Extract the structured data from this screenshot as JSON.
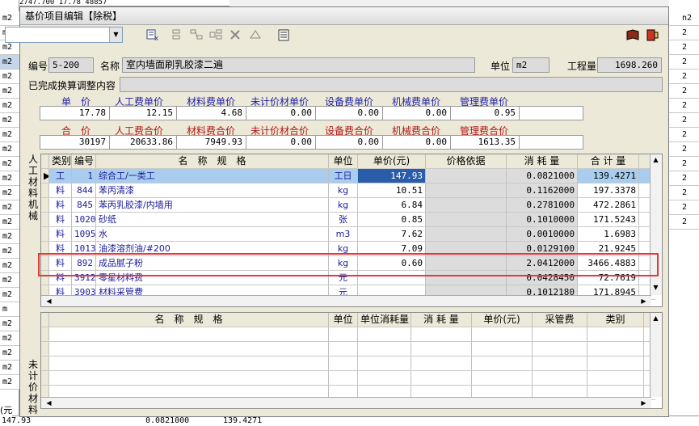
{
  "background": {
    "left_units": [
      "m2",
      "m2",
      "m2",
      "m2",
      "m2",
      "m2",
      "m2",
      "m2",
      "m2",
      "m2",
      "m2",
      "m2",
      "m2",
      "m2",
      "m2",
      "m2",
      "m2",
      "m2",
      "m2",
      "m2",
      "m",
      "m2",
      "m2",
      "m2",
      "m2",
      "m2"
    ],
    "top_row": "2747.700      17.78      48857",
    "right_units": [
      "n2",
      "2",
      "2",
      "2",
      "2",
      "2",
      "2",
      "2",
      "2",
      "2",
      "2",
      "2",
      "2",
      "2",
      "2"
    ],
    "bottom_left": "(元",
    "bottom_row": [
      "147.93",
      "0.0821000",
      "139.4271"
    ]
  },
  "dialog": {
    "title": "基价项目编辑【除税】",
    "toolbar": {
      "combo_value": ""
    },
    "info": {
      "code_label": "编号",
      "code_value": "5-200",
      "name_label": "名称",
      "name_value": "室内墙面刷乳胶漆二遍",
      "unit_label": "单位",
      "unit_value": "m2",
      "qty_label": "工程量",
      "qty_value": "1698.260",
      "adjust_label": "已完成换算调整内容",
      "adjust_value": ""
    },
    "unit_price": {
      "headers": [
        "单　价",
        "人工费单价",
        "材料费单价",
        "未计价材单价",
        "设备费单价",
        "机械费单价",
        "管理费单价"
      ],
      "values": [
        "17.78",
        "12.15",
        "4.68",
        "0.00",
        "0.00",
        "0.00",
        "0.95",
        ""
      ]
    },
    "total_price": {
      "headers": [
        "合　价",
        "人工费合价",
        "材料费合价",
        "未计价材合价",
        "设备费合价",
        "机械费合价",
        "管理费合价"
      ],
      "values": [
        "30197",
        "20633.86",
        "7949.93",
        "0.00",
        "0.00",
        "0.00",
        "1613.35",
        ""
      ]
    },
    "side_label_top": "人工材料机械",
    "side_label_bottom": "未计价材料",
    "grid": {
      "headers": [
        "类别",
        "编号",
        "名　称　规　格",
        "单位",
        "单价(元)",
        "价格依据",
        "消 耗 量",
        "合 计 量"
      ],
      "rows": [
        {
          "type": "工",
          "code": "1",
          "name": "综合工/一类工",
          "unit": "工日",
          "price": "147.93",
          "basis": "",
          "qty": "0.0821000",
          "total": "139.4271",
          "selected": true
        },
        {
          "type": "料",
          "code": "844",
          "name": "苯丙清漆",
          "unit": "kg",
          "price": "10.51",
          "basis": "",
          "qty": "0.1162000",
          "total": "197.3378"
        },
        {
          "type": "料",
          "code": "845",
          "name": "苯丙乳胶漆/内墙用",
          "unit": "kg",
          "price": "6.84",
          "basis": "",
          "qty": "0.2781000",
          "total": "472.2861"
        },
        {
          "type": "料",
          "code": "1020",
          "name": "砂纸",
          "unit": "张",
          "price": "0.85",
          "basis": "",
          "qty": "0.1010000",
          "total": "171.5243"
        },
        {
          "type": "料",
          "code": "1095",
          "name": "水",
          "unit": "m3",
          "price": "7.62",
          "basis": "",
          "qty": "0.0010000",
          "total": "1.6983"
        },
        {
          "type": "料",
          "code": "1013",
          "name": "油漆溶剂油/#200",
          "unit": "kg",
          "price": "7.09",
          "basis": "",
          "qty": "0.0129100",
          "total": "21.9245"
        },
        {
          "type": "料",
          "code": "892",
          "name": "成品腻子粉",
          "unit": "kg",
          "price": "0.60",
          "basis": "",
          "qty": "2.0412000",
          "total": "3466.4883"
        },
        {
          "type": "料",
          "code": "3912",
          "name": "零星材料费",
          "unit": "元",
          "price": "",
          "basis": "",
          "qty": "0.0428450",
          "total": "72.7619"
        },
        {
          "type": "料",
          "code": "3903",
          "name": "材料采管费",
          "unit": "元",
          "price": "",
          "basis": "",
          "qty": "0.1012180",
          "total": "171.8945"
        }
      ]
    },
    "grid2": {
      "headers": [
        "名　称　规　格",
        "单位",
        "单位消耗量",
        "消 耗 量",
        "单价(元)",
        "采管费",
        "类别"
      ]
    }
  }
}
